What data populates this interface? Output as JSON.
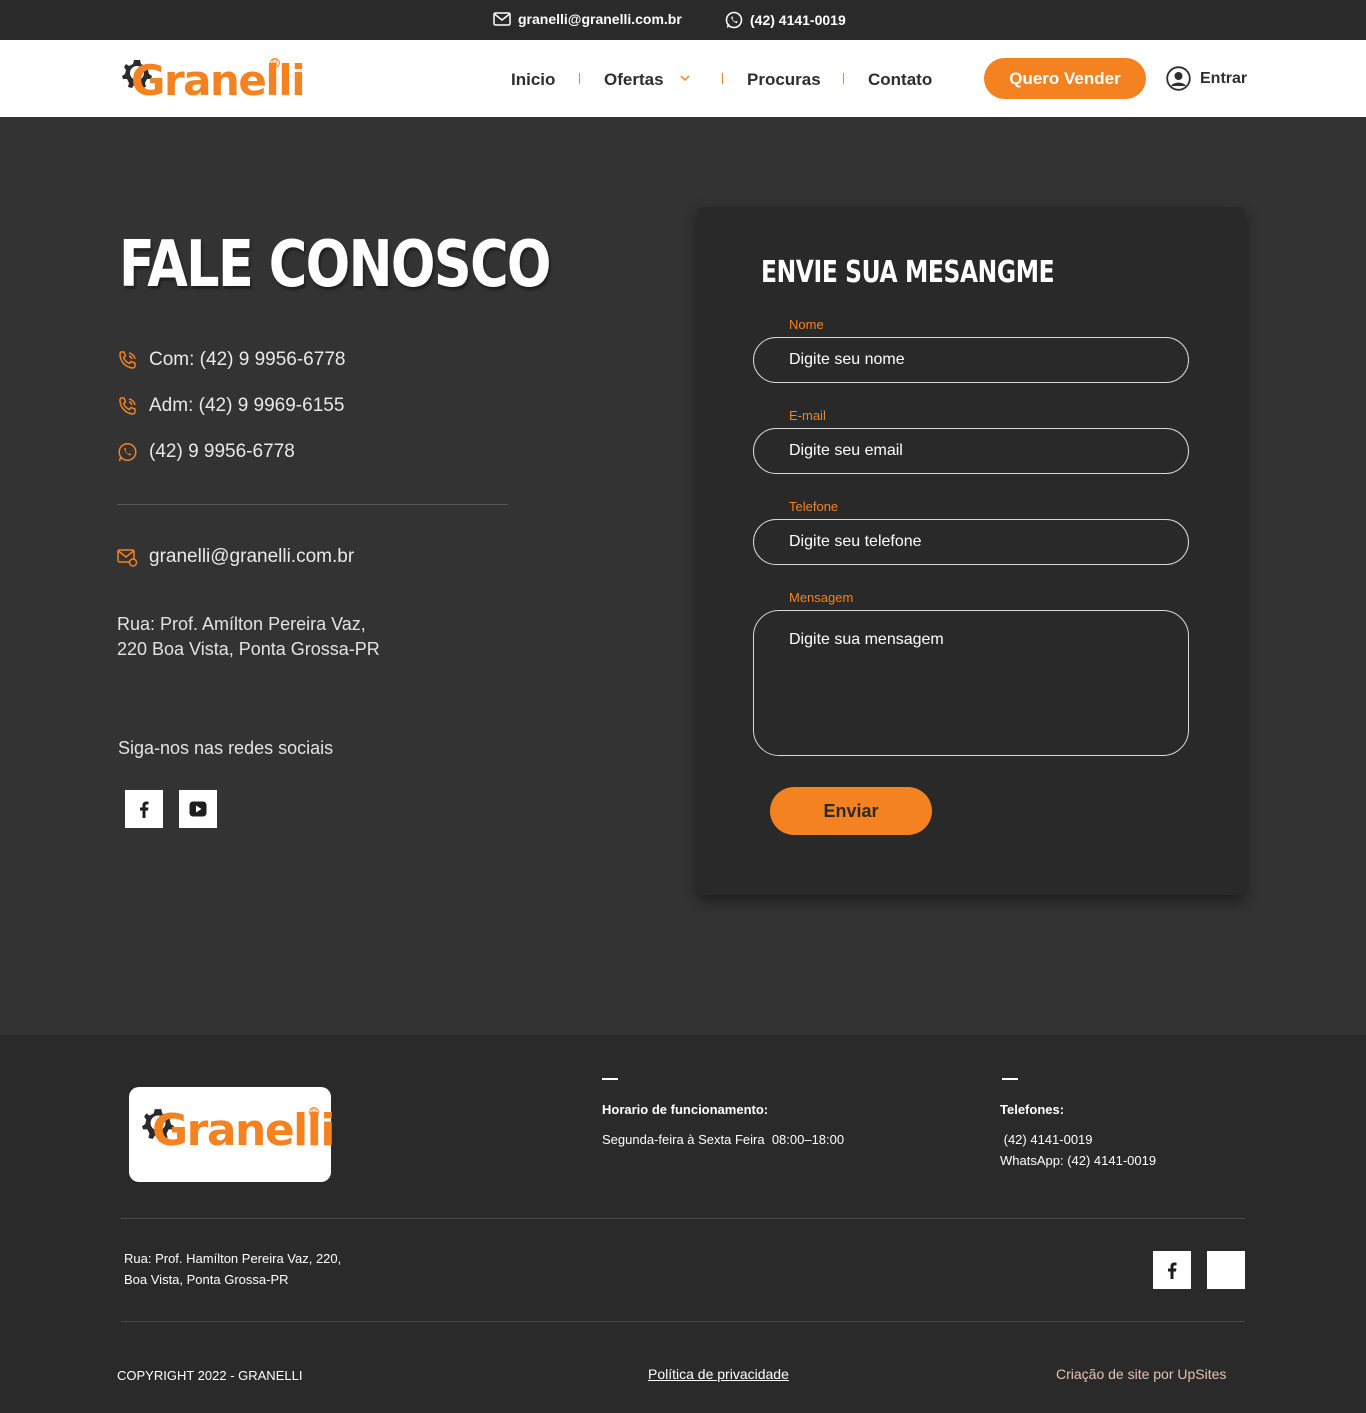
{
  "topbar": {
    "email": "granelli@granelli.com.br",
    "phone": "(42) 4141-0019"
  },
  "header": {
    "logo_text": "Granelli",
    "nav": [
      "Inicio",
      "Ofertas",
      "Procuras",
      "Contato"
    ],
    "cta_label": "Quero Vender",
    "login_label": "Entrar"
  },
  "main": {
    "title": "FALE CONOSCO",
    "phones": [
      "Com: (42) 9 9956-6778",
      "Adm: (42) 9 9969-6155",
      "(42) 9 9956-6778"
    ],
    "email": "granelli@granelli.com.br",
    "address_line1": "Rua: Prof. Amílton Pereira Vaz,",
    "address_line2": "220 Boa Vista, Ponta Grossa-PR",
    "follow_label": "Siga-nos nas redes sociais"
  },
  "form": {
    "title": "ENVIE SUA MESANGME",
    "name_label": "Nome",
    "name_placeholder": "Digite seu nome",
    "email_label": "E-mail",
    "email_placeholder": "Digite seu email",
    "phone_label": "Telefone",
    "phone_placeholder": "Digite seu telefone",
    "message_label": "Mensagem",
    "message_placeholder": "Digite sua mensagem",
    "submit_label": "Enviar"
  },
  "footer": {
    "logo_text": "Granelli",
    "hours_title": "Horario de funcionamento:",
    "hours_text": "Segunda-feira à Sexta Feira  08:00–18:00",
    "phones_title": "Telefones:",
    "phone_line1": " (42) 4141-0019",
    "phone_line2": "WhatsApp: (42) 4141-0019",
    "address_line1": "Rua: Prof. Hamílton Pereira Vaz, 220,",
    "address_line2": "Boa Vista, Ponta Grossa-PR",
    "copyright": "COPYRIGHT 2022 - GRANELLI",
    "privacy": "Política de privacidade",
    "credit": "Criação de site por UpSites"
  },
  "colors": {
    "accent": "#f58220",
    "dark": "#2a2a2a",
    "background": "#333333"
  }
}
